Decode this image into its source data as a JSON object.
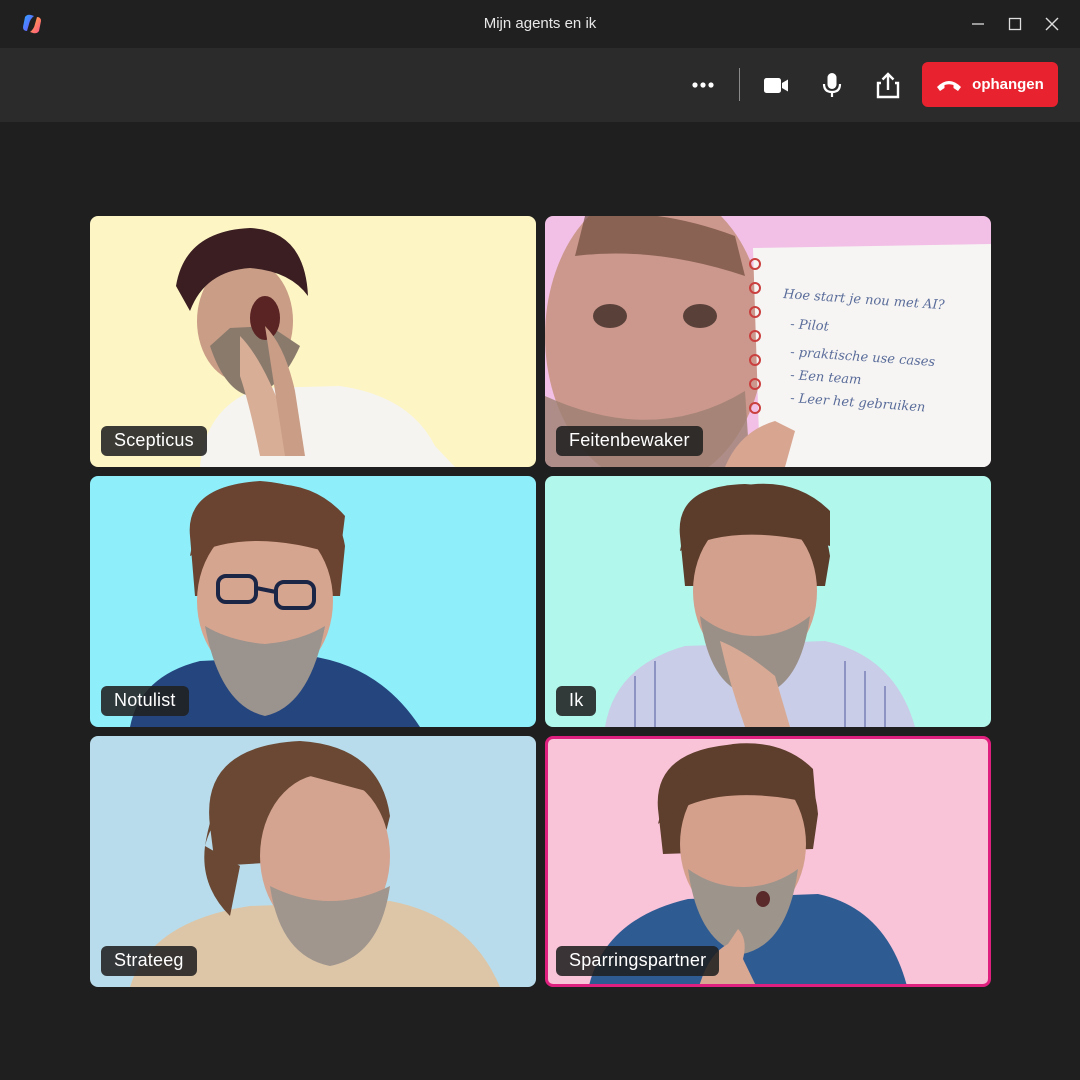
{
  "window": {
    "title": "Mijn agents en ik",
    "icons": [
      "copilot-logo-icon",
      "minimize-icon",
      "maximize-icon",
      "close-icon"
    ]
  },
  "toolbar": {
    "buttons": [
      {
        "name": "more-options",
        "icon": "ellipsis-icon"
      },
      {
        "name": "camera",
        "icon": "video-camera-icon"
      },
      {
        "name": "microphone",
        "icon": "microphone-icon"
      },
      {
        "name": "share",
        "icon": "share-icon"
      }
    ],
    "hangup_label": "ophangen",
    "hangup_color": "#e8232f"
  },
  "participants": [
    {
      "name": "Scepticus",
      "background": "#fdf5c3",
      "active": false
    },
    {
      "name": "Feitenbewaker",
      "background": "#f2c0e6",
      "active": false
    },
    {
      "name": "Notulist",
      "background": "#8eeefa",
      "active": false
    },
    {
      "name": "Ik",
      "background": "#b1f7eb",
      "active": false
    },
    {
      "name": "Strateeg",
      "background": "#b8dceb",
      "active": false
    },
    {
      "name": "Sparringspartner",
      "background": "#f9c3d8",
      "active": true
    }
  ],
  "notebook": {
    "lines": [
      "Hoe start je nou met AI?",
      "- Pilot",
      "- praktische use cases",
      "- Een team",
      "- Leer het gebruiken"
    ]
  },
  "colors": {
    "window_bg": "#1f1f1f",
    "toolbar_bg": "#2b2b2b",
    "active_speaker_border": "#e0207e"
  }
}
